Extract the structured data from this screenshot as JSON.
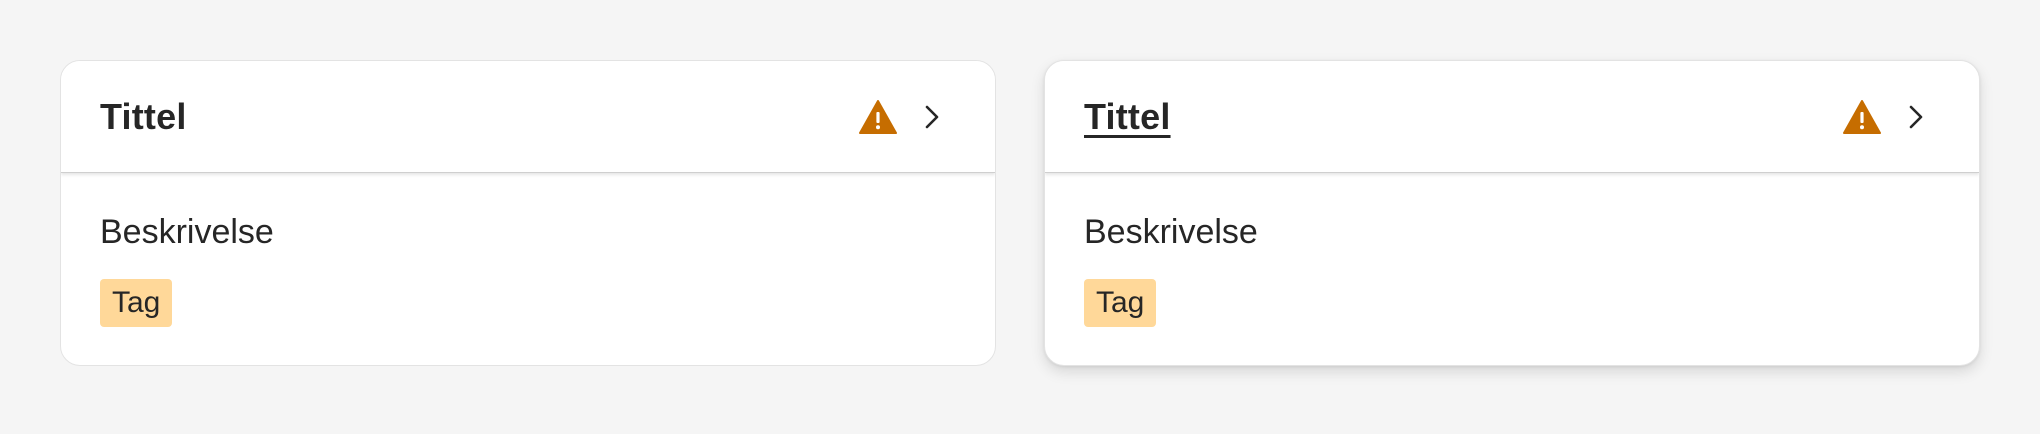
{
  "cards": [
    {
      "title": "Tittel",
      "description": "Beskrivelse",
      "tag": "Tag",
      "state": "default"
    },
    {
      "title": "Tittel",
      "description": "Beskrivelse",
      "tag": "Tag",
      "state": "hover"
    }
  ],
  "colors": {
    "page_background": "#f5f5f5",
    "card_background": "#ffffff",
    "warning": "#c66d00",
    "tag_background": "#ffd899",
    "text": "#262626"
  },
  "icons": {
    "status": "warning-triangle-icon",
    "navigation": "chevron-right-icon"
  }
}
